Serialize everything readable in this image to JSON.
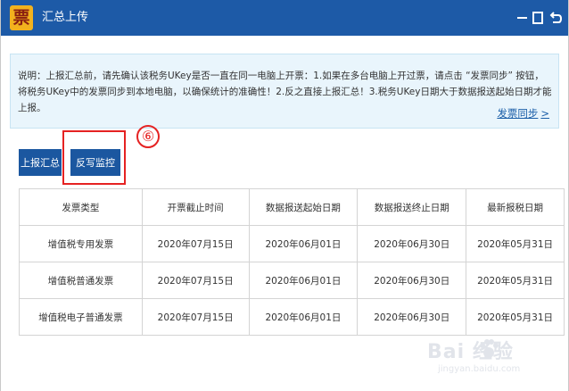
{
  "window": {
    "logo_char": "票",
    "title": "汇总上传",
    "minimize_icon": "minimize-icon",
    "restore_icon": "restore-icon",
    "close_icon": "back-close-icon"
  },
  "notice": {
    "text": "说明：上报汇总前，请先确认该税务UKey是否一直在同一电脑上开票：1.如果在多台电脑上开过票，请点击 “发票同步” 按钮，将税务UKey中的发票同步到本地电脑，以确保统计的准确性！2.反之直接上报汇总！3.税务UKey日期大于数据报送起始日期才能上报。",
    "sync_label": "发票同步",
    "sync_icon": "chevron-right-icon"
  },
  "toolbar": {
    "report_label": "上报汇总",
    "monitor_label": "反写监控"
  },
  "annotation": {
    "step_label": "⑥",
    "color": "#e52222"
  },
  "table": {
    "headers": [
      "发票类型",
      "开票截止时间",
      "数据报送起始日期",
      "数据报送终止日期",
      "最新报税日期"
    ],
    "rows": [
      [
        "增值税专用发票",
        "2020年07月15日",
        "2020年06月01日",
        "2020年06月30日",
        "2020年05月31日"
      ],
      [
        "增值税普通发票",
        "2020年07月15日",
        "2020年06月01日",
        "2020年06月30日",
        "2020年05月31日"
      ],
      [
        "增值税电子普通发票",
        "2020年07月15日",
        "2020年06月01日",
        "2020年06月30日",
        "2020年05月31日"
      ]
    ]
  },
  "watermark": {
    "brand": "Bai  经验",
    "sub": "jingyan.baidu.com"
  },
  "colors": {
    "title_bar": "#1d5aa7",
    "button": "#1b57a0",
    "link": "#1a5ea8",
    "notice_bg": "#e9f5fc"
  }
}
